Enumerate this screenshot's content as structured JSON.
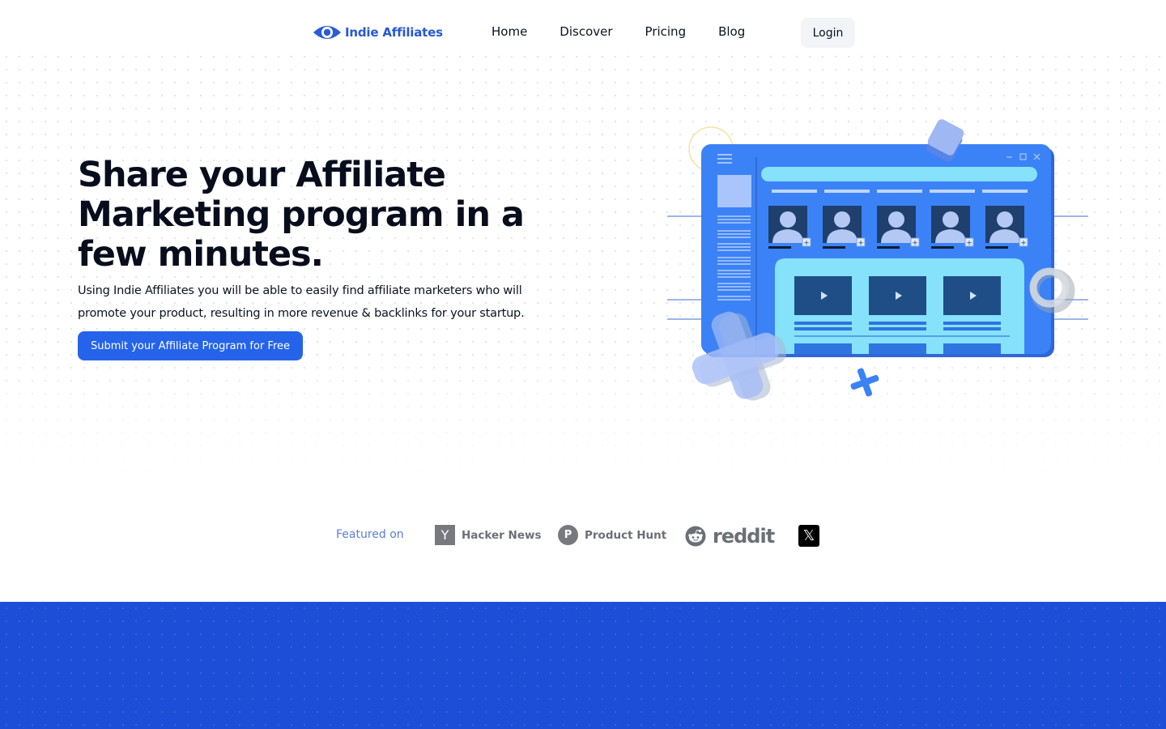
{
  "brand": {
    "name": "Indie Affiliates",
    "icon": "eye-icon",
    "color": "#2657d6"
  },
  "nav": {
    "items": [
      "Home",
      "Discover",
      "Pricing",
      "Blog"
    ],
    "login_label": "Login"
  },
  "hero": {
    "title": "Share your Affiliate Marketing program in a few minutes.",
    "description": "Using Indie Affiliates you will be able to easily find affiliate marketers who will promote your product, resulting in more revenue & backlinks for your startup.",
    "cta_label": "Submit your Affiliate Program for Free",
    "accent": "#2563eb"
  },
  "featured": {
    "label": "Featured on",
    "logos": [
      {
        "name": "Hacker News",
        "icon": "hacker-news-icon",
        "glyph": "Y"
      },
      {
        "name": "Product Hunt",
        "icon": "product-hunt-icon",
        "glyph": "P"
      },
      {
        "name": "reddit",
        "icon": "reddit-icon"
      },
      {
        "name": "X",
        "icon": "x-icon",
        "glyph": "𝕏"
      }
    ]
  },
  "colors": {
    "primary": "#2563eb",
    "section_blue": "#1d4ed8",
    "illustration_blue": "#3b82f6",
    "illustration_light": "#7dd3fc"
  }
}
